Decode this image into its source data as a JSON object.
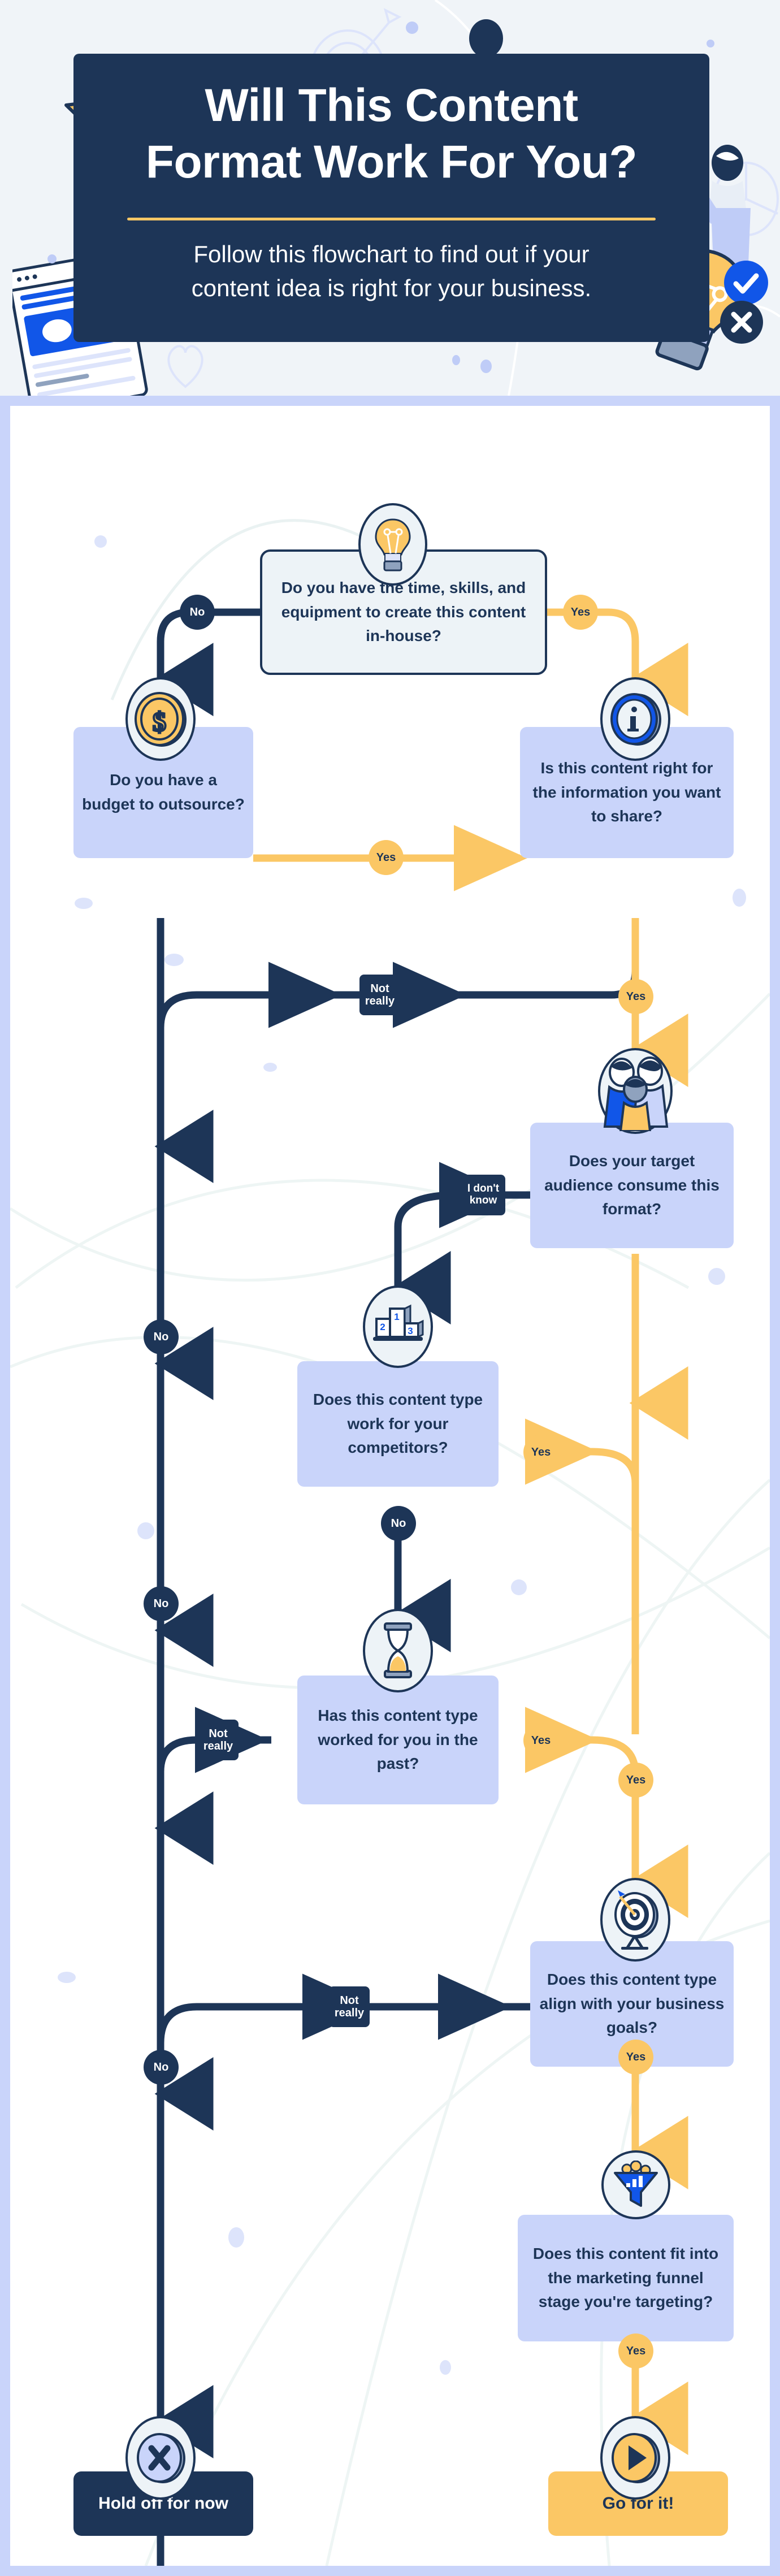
{
  "header": {
    "title_line1": "Will This Content",
    "title_line2": "Format Work For You?",
    "subtitle": "Follow this flowchart to find out if your content idea is right for your business.",
    "decorations": [
      "star-icon",
      "target-icon",
      "person-avatar-icon",
      "pie-chart-icon",
      "browser-window-icon",
      "heart-icon",
      "lightbulb-icon",
      "check-badge-icon",
      "close-badge-icon"
    ]
  },
  "colors": {
    "navy": "#1D3557",
    "gold": "#FBC765",
    "lavender": "#C9D4FA",
    "pale_blue": "#EDF3F7",
    "blue": "#1156E8",
    "header_bg": "#F0F4F8",
    "white": "#FFFFFF"
  },
  "flowchart": {
    "type": "decision-flowchart",
    "nodes": [
      {
        "id": "q1",
        "icon": "lightbulb-icon",
        "style": "outline",
        "text": "Do you have the time, skills, and equipment to create this content in-house?"
      },
      {
        "id": "q2",
        "icon": "dollar-coin-icon",
        "style": "lavender",
        "text": "Do you have a budget to outsource?"
      },
      {
        "id": "q3",
        "icon": "info-circle-icon",
        "style": "lavender",
        "text": "Is this content right for the information you want to share?"
      },
      {
        "id": "q4",
        "icon": "audience-group-icon",
        "style": "lavender",
        "text": "Does your target audience consume this format?"
      },
      {
        "id": "q5",
        "icon": "podium-ranking-icon",
        "style": "lavender",
        "text": "Does this content type work for your competitors?"
      },
      {
        "id": "q6",
        "icon": "hourglass-icon",
        "style": "lavender",
        "text": "Has this content type worked for you in the past?"
      },
      {
        "id": "q7",
        "icon": "dartboard-target-icon",
        "style": "lavender",
        "text": "Does this content type align with your business goals?"
      },
      {
        "id": "q8",
        "icon": "marketing-funnel-icon",
        "style": "lavender",
        "text": "Does this content fit into the marketing funnel stage you're targeting?"
      },
      {
        "id": "end_no",
        "icon": "x-circle-icon",
        "style": "navy",
        "text": "Hold off for now"
      },
      {
        "id": "end_yes",
        "icon": "play-circle-icon",
        "style": "gold",
        "text": "Go for it!"
      }
    ],
    "edges": [
      {
        "from": "q1",
        "to": "q2",
        "label": "No",
        "color": "navy"
      },
      {
        "from": "q1",
        "to": "q3",
        "label": "Yes",
        "color": "gold"
      },
      {
        "from": "q2",
        "to": "q3",
        "label": "Yes",
        "color": "gold"
      },
      {
        "from": "q2",
        "to": "end_no",
        "label": "",
        "color": "navy"
      },
      {
        "from": "q3",
        "to": "q4",
        "label": "Yes",
        "color": "gold"
      },
      {
        "from": "q3",
        "to": "end_no",
        "label": "Not really",
        "color": "navy"
      },
      {
        "from": "q4",
        "to": "q5",
        "label": "I don't know",
        "color": "navy"
      },
      {
        "from": "q4",
        "to": "q7",
        "label": "Yes",
        "color": "gold"
      },
      {
        "from": "q5",
        "to": "q7",
        "label": "Yes",
        "color": "gold"
      },
      {
        "from": "q5",
        "to": "q6",
        "label": "No",
        "color": "navy"
      },
      {
        "from": "q6",
        "to": "q7",
        "label": "Yes",
        "color": "gold"
      },
      {
        "from": "q6",
        "to": "end_no",
        "label": "Not really",
        "color": "navy"
      },
      {
        "from": "q7",
        "to": "q8",
        "label": "Yes",
        "color": "gold"
      },
      {
        "from": "q7",
        "to": "end_no",
        "label": "Not really",
        "color": "navy"
      },
      {
        "from": "q8",
        "to": "end_yes",
        "label": "Yes",
        "color": "gold"
      },
      {
        "from": "q8",
        "to": "end_no",
        "label": "No",
        "color": "navy"
      }
    ],
    "edge_labels": {
      "yes": "Yes",
      "no": "No",
      "not_really": "Not really",
      "not_really_l1": "Not",
      "not_really_l2": "really",
      "idk_l1": "I don't",
      "idk_l2": "know"
    },
    "podium_numbers": {
      "first": "1",
      "second": "2",
      "third": "3"
    }
  }
}
